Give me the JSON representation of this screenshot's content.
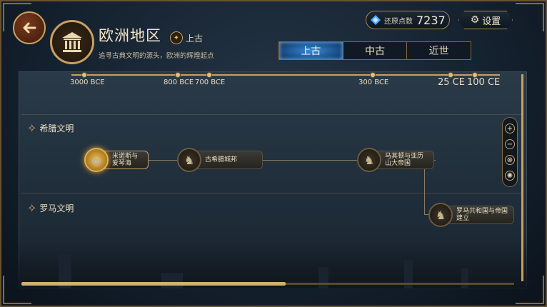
{
  "header": {
    "back_icon": "back-arrow-icon",
    "region_title": "欧洲地区",
    "era_tag": "上古",
    "subtitle": "追寻古典文明的源头，欧洲的辉煌起点",
    "points_label": "还原点数",
    "points_value": "7237",
    "settings_label": "设置"
  },
  "tabs": [
    {
      "label": "上古",
      "active": true
    },
    {
      "label": "中古",
      "active": false
    },
    {
      "label": "近世",
      "active": false
    }
  ],
  "timeline": {
    "ticks": [
      "3000 BCE",
      "800 BCE",
      "700 BCE",
      "300 BCE",
      "25 CE",
      "100 CE"
    ]
  },
  "civilizations": [
    {
      "name": "希腊文明",
      "nodes": [
        {
          "label": "米诺斯与爱琴海",
          "active": true
        },
        {
          "label": "古希腊城邦",
          "active": false
        },
        {
          "label": "马其顿与亚历山大帝国",
          "active": false
        }
      ]
    },
    {
      "name": "罗马文明",
      "nodes": [
        {
          "label": "罗马共和国与帝国建立",
          "active": false
        }
      ]
    }
  ],
  "zoom": {
    "zoom_in": "+",
    "zoom_out": "−"
  },
  "colors": {
    "accent_gold": "#c9a060",
    "active_tab_blue": "#3a8ad8",
    "back_button": "#7a3a1c"
  }
}
